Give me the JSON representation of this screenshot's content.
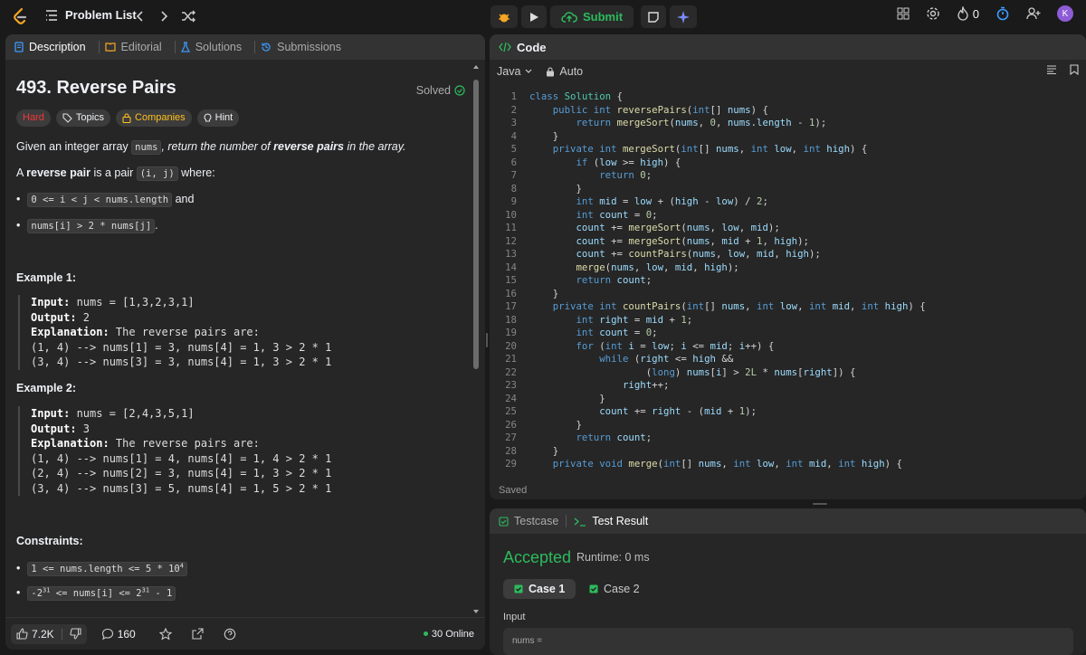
{
  "topbar": {
    "problem_list": "Problem List",
    "submit": "Submit",
    "streak": "0",
    "avatar": "K"
  },
  "left_tabs": [
    "Description",
    "Editorial",
    "Solutions",
    "Submissions"
  ],
  "problem": {
    "title": "493. Reverse Pairs",
    "status": "Solved",
    "chips": [
      "Hard",
      "Topics",
      "Companies",
      "Hint"
    ],
    "desc1_pre": "Given an integer array ",
    "desc1_code": "nums",
    "desc1_mid": ", return the number of ",
    "desc1_bold": "reverse pairs",
    "desc1_post": " in the array.",
    "desc2_pre": "A ",
    "desc2_bold": "reverse pair",
    "desc2_mid": " is a pair ",
    "desc2_code": "(i, j)",
    "desc2_post": " where:",
    "bullet1_code": "0 <= i < j < nums.length",
    "bullet1_post": " and",
    "bullet2_code": "nums[i] > 2 * nums[j]",
    "bullet2_post": ".",
    "ex1_title": "Example 1:",
    "ex2_title": "Example 2:",
    "input_label": "Input:",
    "output_label": "Output:",
    "explanation_label": "Explanation:",
    "ex1_input": " nums = [1,3,2,3,1]",
    "ex1_output": " 2",
    "ex1_expl": " The reverse pairs are:",
    "ex1_lines": [
      "(1, 4) --> nums[1] = 3, nums[4] = 1, 3 > 2 * 1",
      "(3, 4) --> nums[3] = 3, nums[4] = 1, 3 > 2 * 1"
    ],
    "ex2_input": " nums = [2,4,3,5,1]",
    "ex2_output": " 3",
    "ex2_expl": " The reverse pairs are:",
    "ex2_lines": [
      "(1, 4) --> nums[1] = 4, nums[4] = 1, 4 > 2 * 1",
      "(2, 4) --> nums[2] = 3, nums[4] = 1, 3 > 2 * 1",
      "(3, 4) --> nums[3] = 5, nums[4] = 1, 5 > 2 * 1"
    ],
    "constraints_title": "Constraints:",
    "c1_pre": "1 <= nums.length <= 5 * 10",
    "c1_sup": "4",
    "c2_a": "-2",
    "c2_sup1": "31",
    "c2_b": " <= nums[i] <= 2",
    "c2_sup2": "31",
    "c2_c": " - 1"
  },
  "footer": {
    "likes": "7.2K",
    "comments": "160",
    "online": "30 Online"
  },
  "code_panel": {
    "title": "Code",
    "language": "Java",
    "mode": "Auto",
    "saved": "Saved"
  },
  "code_lines": [
    "class Solution {",
    "    public int reversePairs(int[] nums) {",
    "        return mergeSort(nums, 0, nums.length - 1);",
    "    }",
    "    private int mergeSort(int[] nums, int low, int high) {",
    "        if (low >= high) {",
    "            return 0;",
    "        }",
    "        int mid = low + (high - low) / 2;",
    "        int count = 0;",
    "        count += mergeSort(nums, low, mid);",
    "        count += mergeSort(nums, mid + 1, high);",
    "        count += countPairs(nums, low, mid, high);",
    "        merge(nums, low, mid, high);",
    "        return count;",
    "    }",
    "    private int countPairs(int[] nums, int low, int mid, int high) {",
    "        int right = mid + 1;",
    "        int count = 0;",
    "        for (int i = low; i <= mid; i++) {",
    "            while (right <= high &&",
    "                    (long) nums[i] > 2L * nums[right]) {",
    "                right++;",
    "            }",
    "            count += right - (mid + 1);",
    "        }",
    "        return count;",
    "    }",
    "    private void merge(int[] nums, int low, int mid, int high) {"
  ],
  "test_panel": {
    "tab_testcase": "Testcase",
    "tab_result": "Test Result",
    "status": "Accepted",
    "runtime": "Runtime: 0 ms",
    "case1": "Case 1",
    "case2": "Case 2",
    "input_label": "Input",
    "input_value": "nums ="
  },
  "colors": {
    "accent_green": "#2cbb5d",
    "hard": "#f63636",
    "companies": "#ffc01e"
  }
}
